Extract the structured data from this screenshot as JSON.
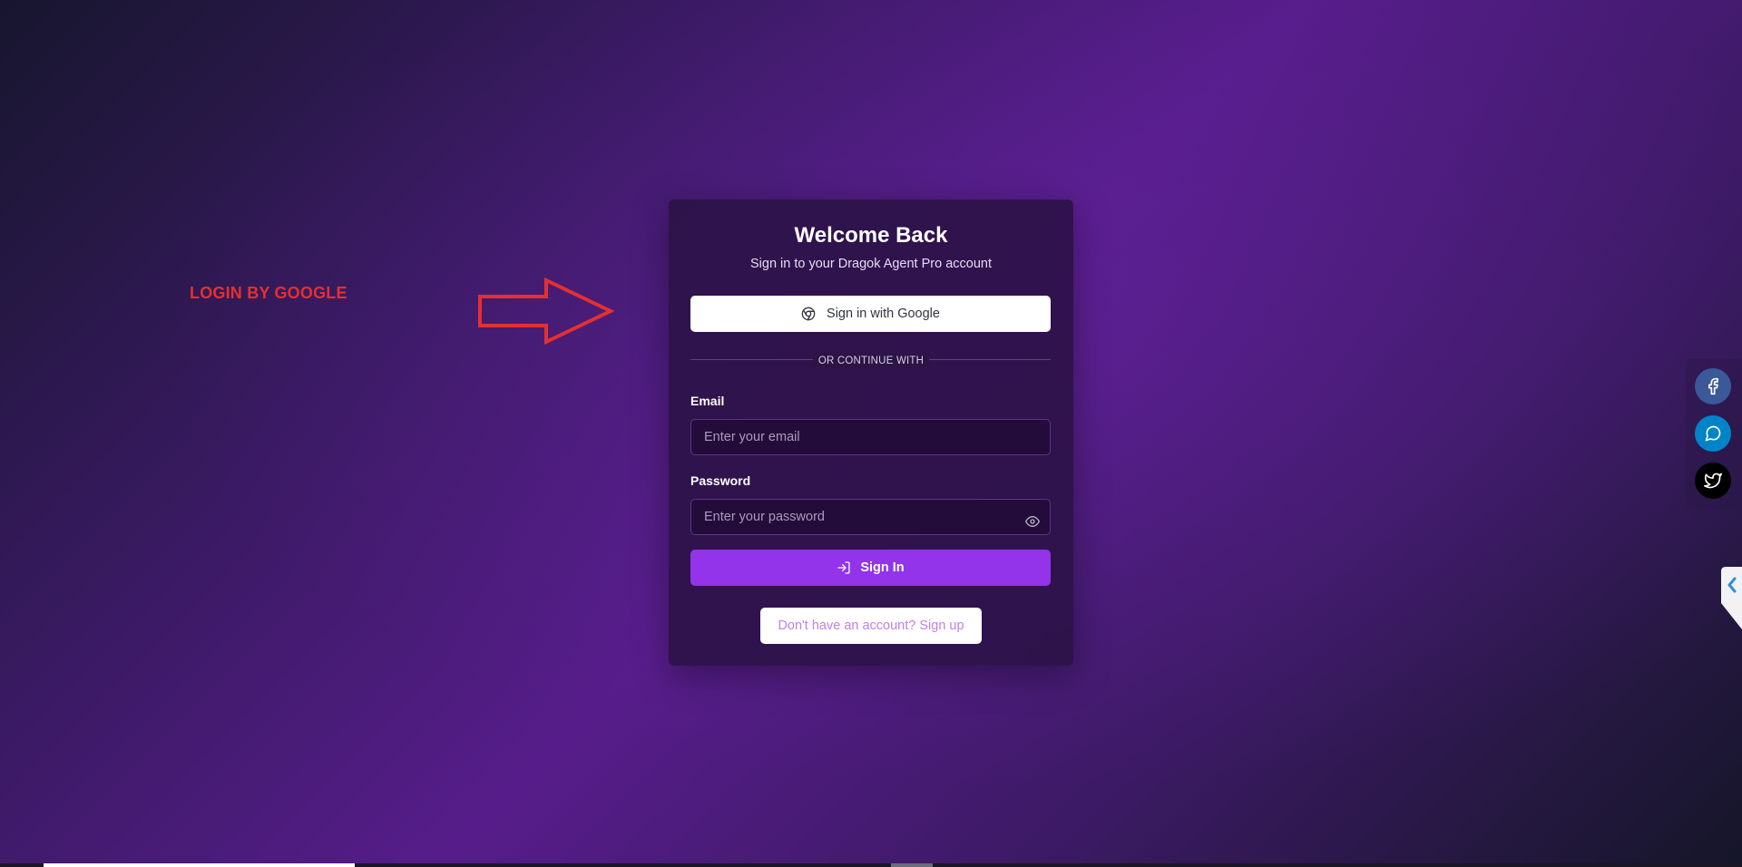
{
  "annotation": {
    "label": "LOGIN BY GOOGLE",
    "color": "#e53030",
    "arrow_icon": "right-arrow-outline"
  },
  "card": {
    "title": "Welcome Back",
    "subtitle": "Sign in to your Dragok Agent Pro account",
    "google_button_label": "Sign in with Google",
    "google_icon": "chrome-icon",
    "divider_text": "OR CONTINUE WITH",
    "email": {
      "label": "Email",
      "placeholder": "Enter your email",
      "value": ""
    },
    "password": {
      "label": "Password",
      "placeholder": "Enter your password",
      "value": "",
      "toggle_icon": "eye-icon"
    },
    "signin_button_label": "Sign In",
    "signin_icon": "log-in-icon",
    "signup_link_label": "Don't have an account? Sign up",
    "accent_color": "#9333ea"
  },
  "social_sidebar": {
    "items": [
      {
        "name": "facebook",
        "icon": "facebook-icon",
        "color": "#3b5998"
      },
      {
        "name": "messenger",
        "icon": "chat-bubble-icon",
        "color": "#0084c7"
      },
      {
        "name": "twitter",
        "icon": "twitter-icon",
        "color": "#000000"
      }
    ],
    "collapse_icon": "chevron-left-icon"
  }
}
